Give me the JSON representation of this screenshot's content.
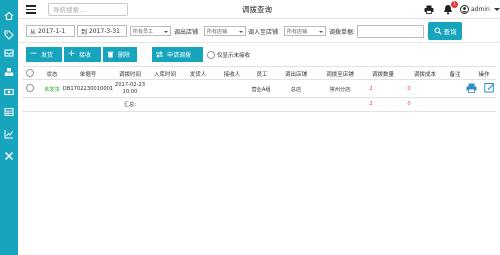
{
  "topbar": {
    "search_placeholder": "导航搜索...",
    "title": "调拨查询",
    "notification_count": "1",
    "user": "admin"
  },
  "filters": {
    "from_label": "从",
    "from_date": "2017-1-1",
    "to_label": "到",
    "to_date": "2017-3-31",
    "employee_select": "所有员工",
    "out_store_label": "调出店铺",
    "out_store_select": "所有店铺",
    "in_store_label": "调入至店铺",
    "in_store_select": "所有店铺",
    "out_store_label2": "调出店铺",
    "out_store_select2": "所有店铺",
    "code_label": "调拨单据:",
    "code_value": "",
    "query_button": "查询"
  },
  "actions": {
    "send": "发货",
    "receive": "接收",
    "delete": "删除",
    "apply": "申请调拨",
    "only_unreceived": "仅显示未接收"
  },
  "table": {
    "headers": [
      "状态",
      "单据号",
      "调拨时间",
      "入库时间",
      "发货人",
      "接收人",
      "员工",
      "调出店铺",
      "调拨至店铺",
      "调拨数量",
      "调拨成本",
      "备注",
      "操作"
    ],
    "rows": [
      {
        "status": "未发货",
        "code": "DB1702230010001",
        "date": "2017-02-23",
        "time": "10:00",
        "in_time": "",
        "sender": "",
        "receiver": "",
        "employee": "营业A组",
        "out_store": "总店",
        "in_store": "常州分店",
        "quantity": "2",
        "cost": "0",
        "note": ""
      }
    ],
    "summary": {
      "label": "汇总:",
      "quantity": "2",
      "cost": "0"
    }
  }
}
